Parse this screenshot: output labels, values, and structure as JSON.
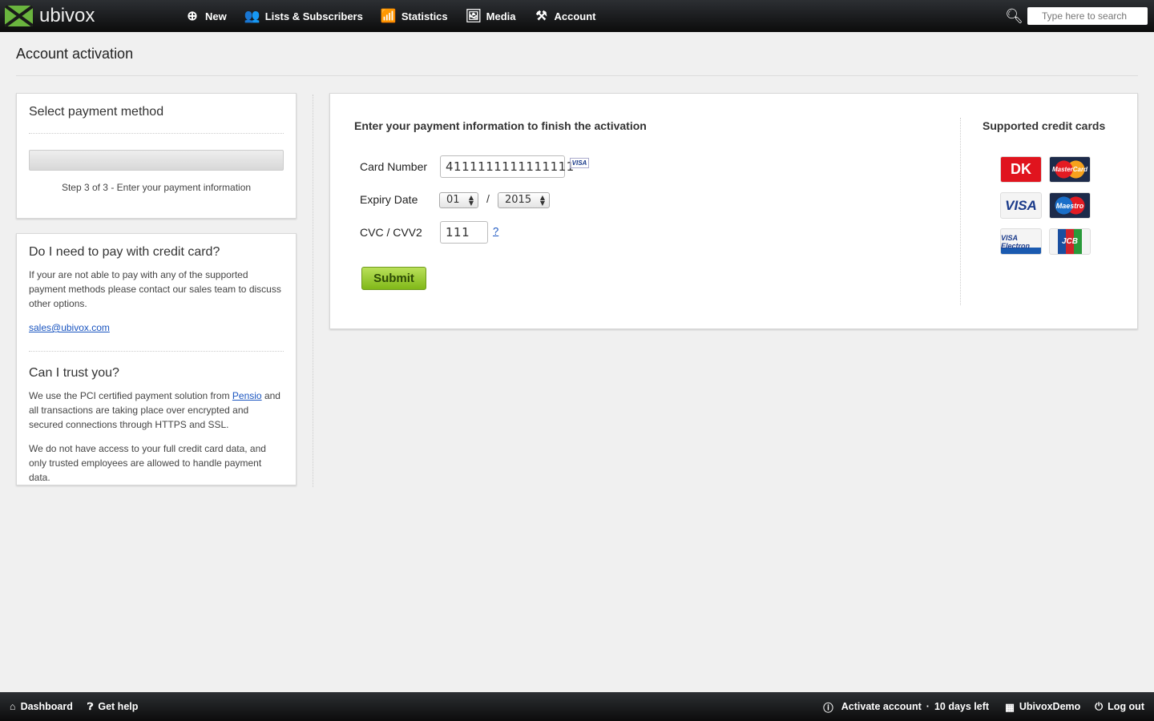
{
  "header": {
    "logo": "ubivox",
    "nav": [
      {
        "label": "New",
        "icon": "plus-circle-icon"
      },
      {
        "label": "Lists & Subscribers",
        "icon": "users-icon"
      },
      {
        "label": "Statistics",
        "icon": "chart-icon"
      },
      {
        "label": "Media",
        "icon": "image-icon"
      },
      {
        "label": "Account",
        "icon": "tools-icon"
      }
    ],
    "search_placeholder": "Type here to search"
  },
  "page_title": "Account activation",
  "payment_method": {
    "title": "Select payment method",
    "progress_percent": 100,
    "step_text": "Step 3 of 3 - Enter your payment information"
  },
  "help": {
    "q1": "Do I need to pay with credit card?",
    "a1": "If your are not able to pay with any of the supported payment methods please contact our sales team to discuss other options.",
    "email": "sales@ubivox.com",
    "q2": "Can I trust you?",
    "a2_pre": "We use the PCI certified payment solution from ",
    "a2_link": "Pensio",
    "a2_post": " and all transactions are taking place over encrypted and secured connections through HTTPS and SSL.",
    "a3": "We do not have access to your full credit card data, and only trusted employees are allowed to handle payment data."
  },
  "form": {
    "heading": "Enter your payment information to finish the activation",
    "card_number_label": "Card Number",
    "card_number": "4111111111111111",
    "card_badge": "VISA",
    "expiry_label": "Expiry Date",
    "month": "01",
    "separator": "/",
    "year": "2015",
    "cvc_label": "CVC / CVV2",
    "cvc": "111",
    "help_link": "?",
    "submit": "Submit"
  },
  "supported": {
    "title": "Supported credit cards",
    "cards": [
      "DK",
      "MasterCard",
      "VISA",
      "Maestro",
      "VISA Electron",
      "JCB"
    ]
  },
  "footer": {
    "dashboard": "Dashboard",
    "help": "Get help",
    "activate": "Activate account",
    "dot": "·",
    "days_left": "10 days left",
    "account": "UbivoxDemo",
    "logout": "Log out"
  }
}
